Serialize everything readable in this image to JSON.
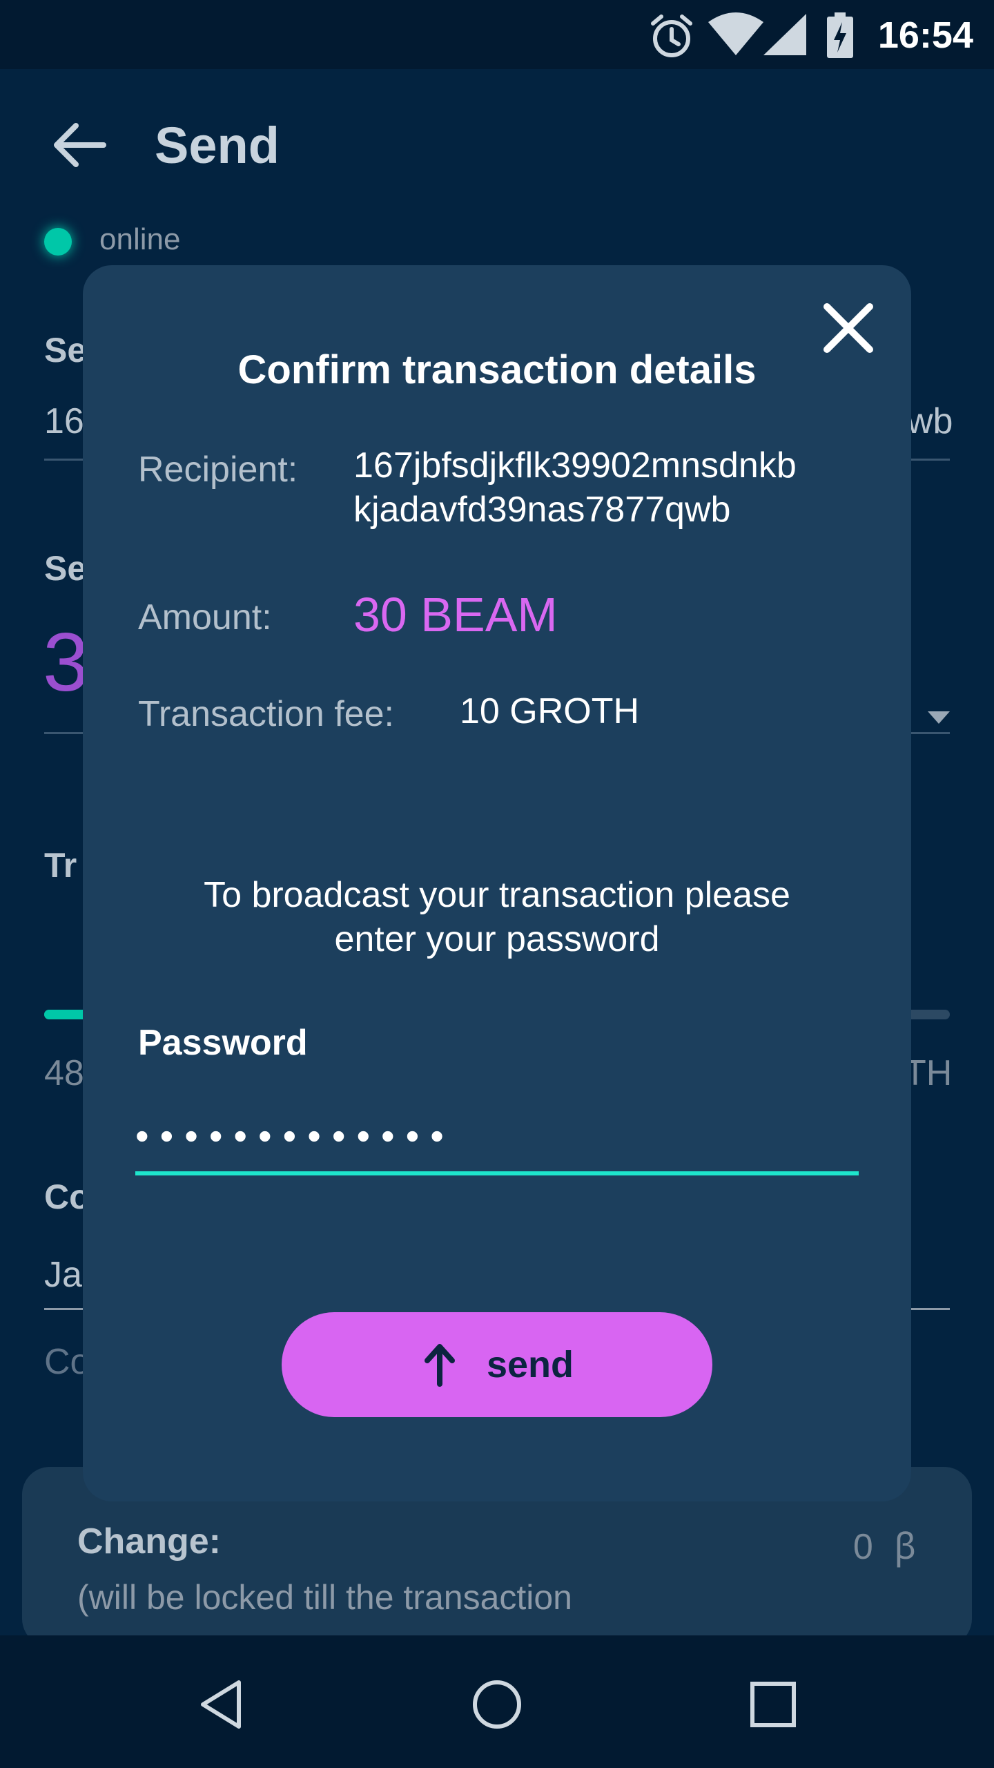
{
  "status_bar": {
    "time": "16:54",
    "icons": [
      "alarm-icon",
      "wifi-icon",
      "signal-icon",
      "battery-icon"
    ]
  },
  "page": {
    "title": "Send",
    "status": "online",
    "fragments": {
      "send_to_label_partial": "Se",
      "address_partial_left": "16",
      "address_partial_right": "wb",
      "amount_label_partial": "Se",
      "amount_partial": "3",
      "fee_label_partial": "Tr",
      "fee_min_partial": "48",
      "fee_max_partial": "TH",
      "comment_label_partial": "Co",
      "comment_partial": "Ja",
      "comment_hint_partial": "Co"
    },
    "change": {
      "label": "Change:",
      "value": "0",
      "currency_symbol": "ꞵ",
      "note": "(will be locked till the transaction"
    }
  },
  "modal": {
    "title": "Confirm transaction details",
    "recipient_label": "Recipient:",
    "recipient_line1": "167jbfsdjkflk39902mnsdnkb",
    "recipient_line2": "kjadavfd39nas7877qwb",
    "amount_label": "Amount:",
    "amount_value": "30 BEAM",
    "fee_label": "Transaction fee:",
    "fee_value": "10 GROTH",
    "instructions_line1": "To broadcast your transaction please",
    "instructions_line2": "enter your password",
    "password_label": "Password",
    "password_value": "•••••••••••••",
    "send_label": "send"
  },
  "colors": {
    "background": "#032340",
    "modal": "#1c3f5d",
    "accent_purple": "#d865f2",
    "accent_teal": "#1ee5cc"
  }
}
